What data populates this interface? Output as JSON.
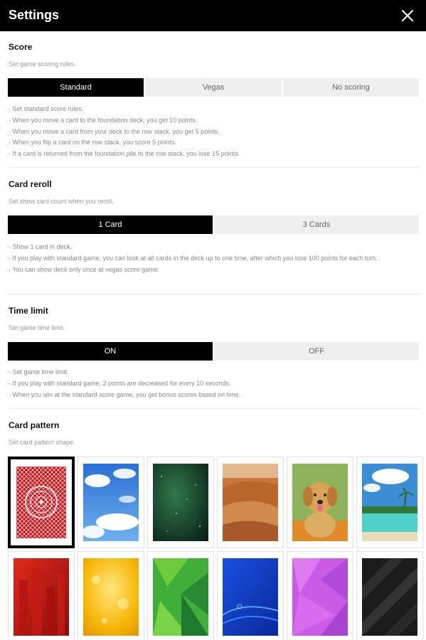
{
  "header": {
    "title": "Settings",
    "close_icon": "close-icon"
  },
  "score": {
    "title": "Score",
    "subtitle": "Set game scoring rules.",
    "options": [
      "Standard",
      "Vegas",
      "No scoring"
    ],
    "selected": "Standard",
    "description": [
      "· Set standard score rules.",
      "· When you move a card to the foundation deck, you get 10 points.",
      "· When you move a card from your deck to the row stack, you get 5 points.",
      "· When you flip a card on the row stack, you score 5 points.",
      "· If a card is returned from the foundation pile to the row stack, you lose 15 points."
    ]
  },
  "card_reroll": {
    "title": "Card reroll",
    "subtitle": "Set show card count when you reroll.",
    "options": [
      "1 Card",
      "3 Cards"
    ],
    "selected": "1 Card",
    "description": [
      "· Show 1 card in deck.",
      "· If you play with standard game, you can look at all cards in the deck up to one time, after which you lose 100 points for each turn.",
      "· You can show deck only once at vegas score game."
    ]
  },
  "time_limit": {
    "title": "Time limit",
    "subtitle": "Set game time limit.",
    "options": [
      "ON",
      "OFF"
    ],
    "selected": "ON",
    "description": [
      "· Set game time limit.",
      "· If you play with standard game, 2 points are decreased for every 10 seconds.",
      "· When you win at the standard score game, you get bonus scores based on time."
    ]
  },
  "card_pattern": {
    "title": "Card pattern",
    "subtitle": "Set card pattern shape.",
    "selected": "red-classic",
    "patterns": [
      "red-classic",
      "sky-clouds",
      "green-space",
      "desert-dunes",
      "golden-puppy",
      "tropical-beach",
      "red-buildings",
      "yellow-glow",
      "green-geometric",
      "blue-waves",
      "purple-polygon",
      "black-stripes"
    ]
  }
}
